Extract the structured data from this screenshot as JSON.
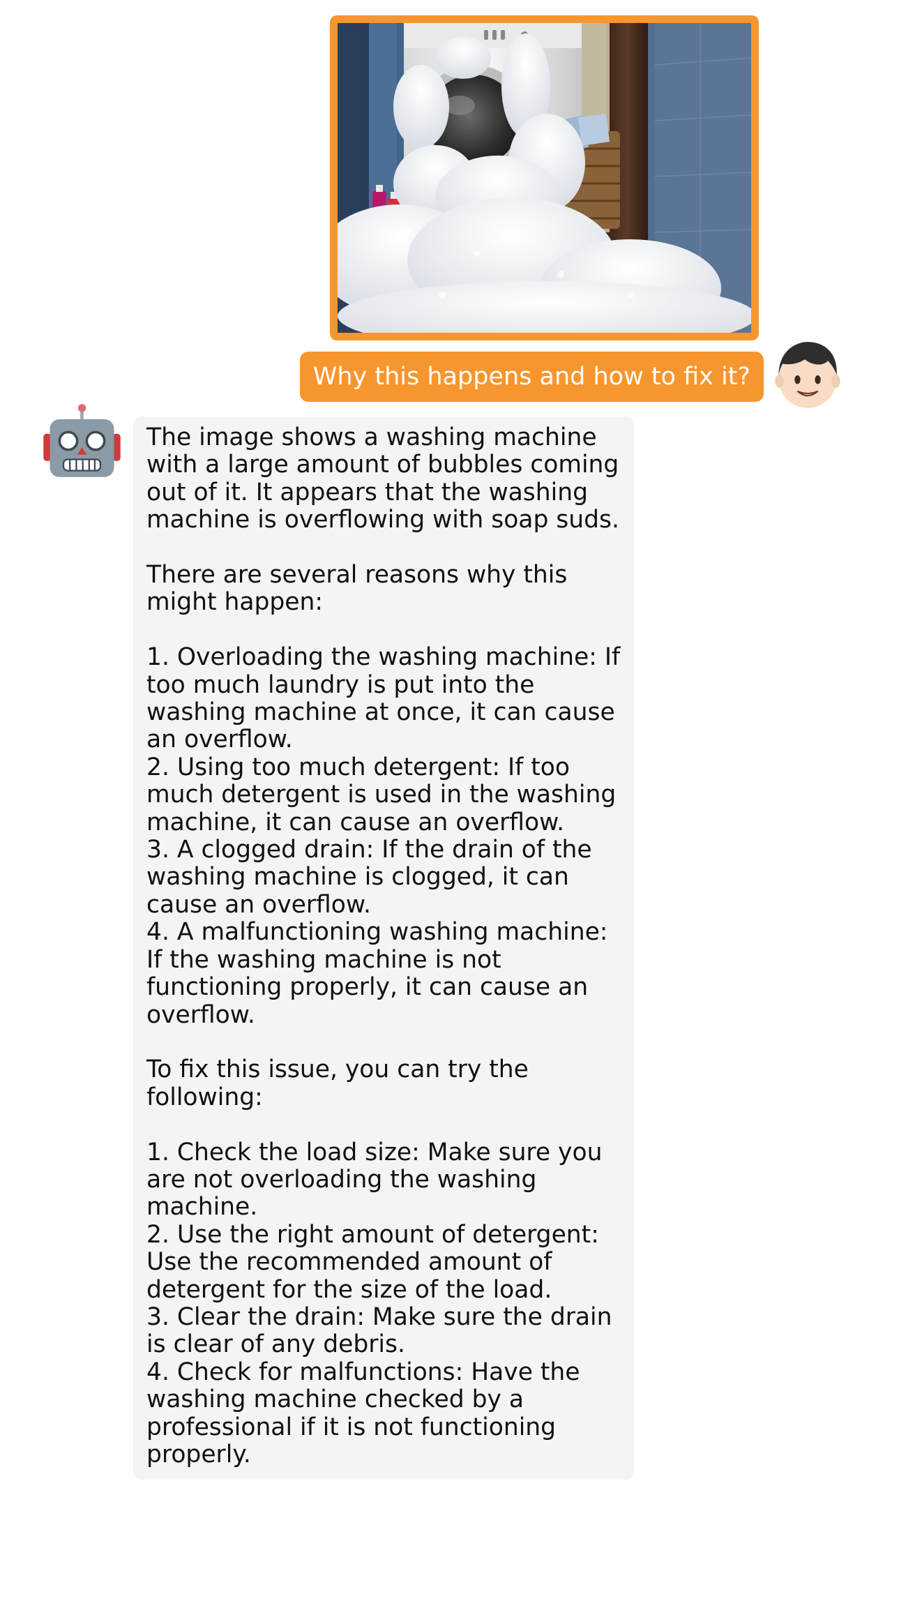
{
  "conversation": {
    "user_image": {
      "icon": "washing-machine-overflowing-photo",
      "frame_color": "#f7962f"
    },
    "user_message": {
      "text": "Why this happens and how to fix it?",
      "bubble_color": "#f7962f",
      "avatar_icon": "boy-face-emoji"
    },
    "bot_message": {
      "avatar_icon": "robot-face-emoji",
      "bubble_color": "#f4f4f4",
      "intro": "The image shows a washing machine with a large amount of bubbles coming out of it. It appears that the washing machine is overflowing with soap suds.",
      "reasons_heading": "There are several reasons why this might happen:",
      "reasons": [
        "1. Overloading the washing machine: If too much laundry is put into the washing machine at once, it can cause an overflow.",
        "2. Using too much detergent: If too much detergent is used in the washing machine, it can cause an overflow.",
        "3. A clogged drain: If the drain of the washing machine is clogged, it can cause an overflow.",
        "4. A malfunctioning washing machine: If the washing machine is not functioning properly, it can cause an overflow."
      ],
      "fixes_heading": "To fix this issue, you can try the following:",
      "fixes": [
        "1. Check the load size: Make sure you are not overloading the washing machine.",
        "2. Use the right amount of detergent: Use the recommended amount of detergent for the size of the load.",
        "3. Clear the drain: Make sure the drain is clear of any debris.",
        "4. Check for malfunctions: Have the washing machine checked by a professional if it is not functioning properly."
      ]
    }
  }
}
